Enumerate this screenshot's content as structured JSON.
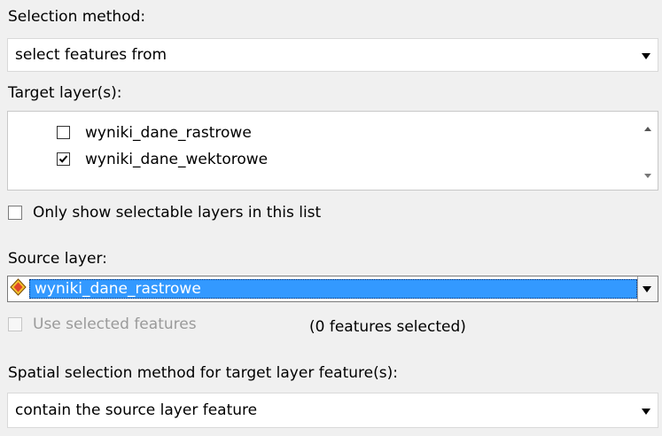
{
  "selection_method": {
    "label": "Selection method:",
    "value": "select features from"
  },
  "target_layers": {
    "label": "Target layer(s):",
    "items": [
      {
        "label": "wyniki_dane_rastrowe",
        "checked": false
      },
      {
        "label": "wyniki_dane_wektorowe",
        "checked": true
      }
    ]
  },
  "only_selectable": {
    "label": "Only show selectable layers in this list",
    "checked": false
  },
  "source_layer": {
    "label": "Source layer:",
    "value": "wyniki_dane_rastrowe",
    "icon": "layer-diamond-icon"
  },
  "use_selected": {
    "label": "Use selected features",
    "enabled": false,
    "count_text": "(0 features selected)"
  },
  "spatial_method": {
    "label": "Spatial selection method for target layer feature(s):",
    "value": "contain the source layer feature"
  },
  "colors": {
    "highlight": "#3399ff",
    "background": "#f0f0f0"
  }
}
